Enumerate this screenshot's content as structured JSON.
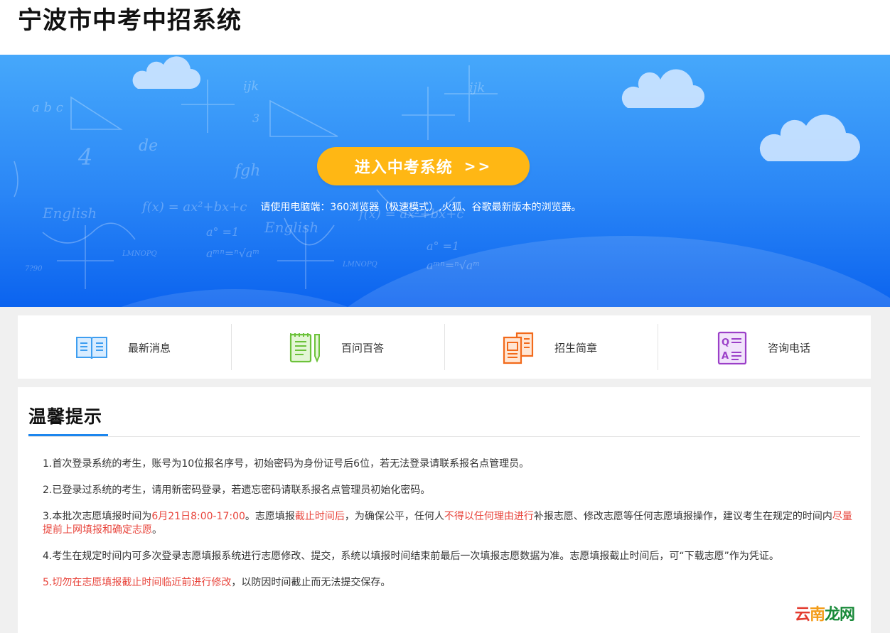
{
  "header": {
    "site_title": "宁波市中考中招系统"
  },
  "hero": {
    "enter_button": "进入中考系统",
    "enter_arrows": ">>",
    "browser_note": "请使用电脑端：360浏览器（极速模式）,火狐、谷歌最新版本的浏览器。"
  },
  "nav": {
    "items": [
      {
        "label": "最新消息",
        "icon": "book-icon",
        "color": "#3e9ef0"
      },
      {
        "label": "百问百答",
        "icon": "notepad-pencil-icon",
        "color": "#6cc23a"
      },
      {
        "label": "招生简章",
        "icon": "brochure-icon",
        "color": "#f26a1b"
      },
      {
        "label": "咨询电话",
        "icon": "qa-icon",
        "color": "#9b3fc8"
      }
    ]
  },
  "tips": {
    "title": "温馨提示",
    "items": [
      {
        "plain": "1.首次登录系统的考生，账号为10位报名序号，初始密码为身份证号后6位，若无法登录请联系报名点管理员。"
      },
      {
        "plain": "2.已登录过系统的考生，请用新密码登录，若遗忘密码请联系报名点管理员初始化密码。"
      },
      {
        "p1": "3.本批次志愿填报时间为",
        "r1": "6月21日8:00-17:00",
        "p2": "。志愿填报",
        "r2": "截止时间后",
        "p3": "，为确保公平，任何人",
        "r3": "不得以任何理由进行",
        "p4": "补报志愿、修改志愿等任何志愿填报操作，建议考生在规定的时间内",
        "r4": "尽量提前上网填报和确定志愿",
        "p5": "。"
      },
      {
        "plain": "4.考生在规定时间内可多次登录志愿填报系统进行志愿修改、提交，系统以填报时间结束前最后一次填报志愿数据为准。志愿填报截止时间后，可“下载志愿”作为凭证。"
      },
      {
        "r1": "5.切勿在志愿填报截止时间临近前进行修改",
        "p1": "，以防因时间截止而无法提交保存。"
      }
    ]
  },
  "watermark": {
    "part1": "云",
    "part2": "南",
    "part3": "龙网"
  },
  "colors": {
    "accent": "#1c86ee",
    "button": "#ffb714",
    "warning": "#e8453c"
  }
}
